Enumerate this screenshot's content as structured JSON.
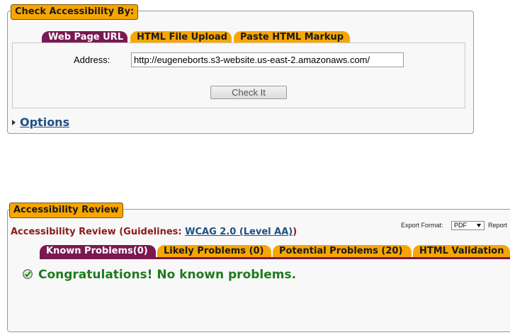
{
  "check_section": {
    "legend": "Check Accessibility By:",
    "tabs": [
      {
        "label": "Web Page URL",
        "active": true
      },
      {
        "label": "HTML File Upload",
        "active": false
      },
      {
        "label": "Paste HTML Markup",
        "active": false
      }
    ],
    "address_label": "Address:",
    "address_value": "http://eugeneborts.s3-website.us-east-2.amazonaws.com/",
    "check_button": "Check It",
    "options_link": "Options"
  },
  "review_section": {
    "legend": "Accessibility Review",
    "heading_prefix": "Accessibility Review (Guidelines: ",
    "guideline_link": "WCAG 2.0 (Level AA)",
    "heading_suffix": ")",
    "export_label": "Export Format:",
    "export_value": "PDF",
    "report_label": "Report",
    "tabs": [
      {
        "label": "Known Problems(0)",
        "active": true
      },
      {
        "label": "Likely Problems (0)",
        "active": false
      },
      {
        "label": "Potential Problems (20)",
        "active": false
      },
      {
        "label": "HTML Validation",
        "active": false
      }
    ],
    "congrats_message": "Congratulations! No known problems."
  },
  "colors": {
    "tab_active": "#7a1850",
    "tab_inactive": "#f7a600",
    "success": "#1f7a1f",
    "link": "#1f4f86",
    "heading": "#8b1a1a"
  }
}
